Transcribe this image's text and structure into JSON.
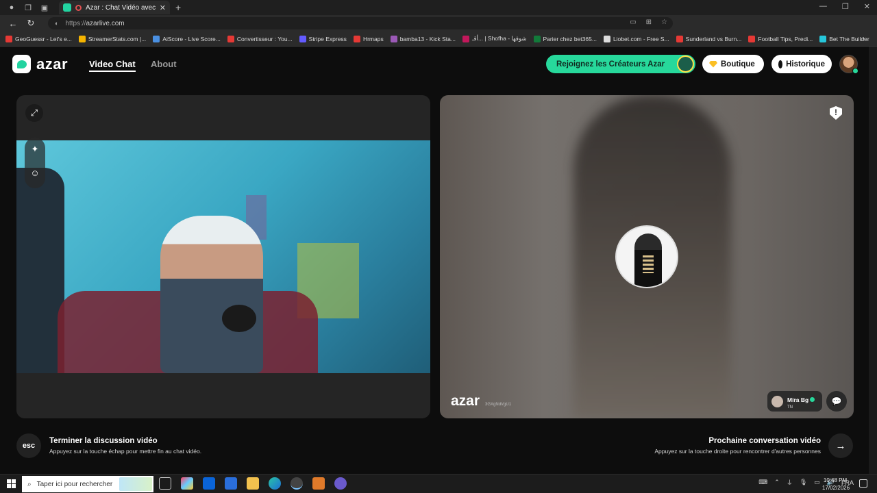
{
  "browser": {
    "tab_title": "Azar : Chat Vidéo avec de n",
    "url_prefix": "https://",
    "url_host": "azarlive.com",
    "bookmarks": [
      {
        "label": "GeoGuessr - Let's e...",
        "color": "#e53935"
      },
      {
        "label": "StreamerStats.com |...",
        "color": "#f5b400"
      },
      {
        "label": "AiScore - Live Score...",
        "color": "#4a90e2"
      },
      {
        "label": "Convertisseur : You...",
        "color": "#e53935"
      },
      {
        "label": "Stripe Express",
        "color": "#635bff"
      },
      {
        "label": "Hrmaps",
        "color": "#e53935"
      },
      {
        "label": "bamba13 - Kick Sta...",
        "color": "#9b59b6"
      },
      {
        "label": "أقـ... | Shofha - شوفها",
        "color": "#c2185b"
      },
      {
        "label": "Parier chez bet365...",
        "color": "#127a3a"
      },
      {
        "label": "Liobet.com - Free S...",
        "color": "#dddddd"
      },
      {
        "label": "Sunderland vs Burn...",
        "color": "#e53935"
      },
      {
        "label": "Football Tips, Predi...",
        "color": "#e53935"
      },
      {
        "label": "Bet The Builder",
        "color": "#26c6da"
      }
    ]
  },
  "header": {
    "logo_text": "azar",
    "nav_video_chat": "Video Chat",
    "nav_about": "About",
    "creators_label": "Rejoignez les Créateurs Azar",
    "boutique_label": "Boutique",
    "historique_label": "Historique"
  },
  "peer": {
    "watermark": "azar",
    "watermark_id": "3GXgNdVgU1",
    "name": "Mira Bg",
    "country": "TN"
  },
  "bottom": {
    "esc_key": "esc",
    "end_title": "Terminer la discussion vidéo",
    "end_sub": "Appuyez sur la touche échap pour mettre fin au chat vidéo.",
    "next_title": "Prochaine conversation vidéo",
    "next_sub": "Appuyez sur la touche droite pour rencontrer d'autres personnes"
  },
  "taskbar": {
    "search_placeholder": "Taper ici pour rechercher",
    "language": "FRA",
    "time": "10:48 PM",
    "date": "17/02/2026"
  },
  "colors": {
    "accent_green": "#27d89b",
    "page_bg": "#0d0d0d",
    "panel_bg": "#252525"
  }
}
